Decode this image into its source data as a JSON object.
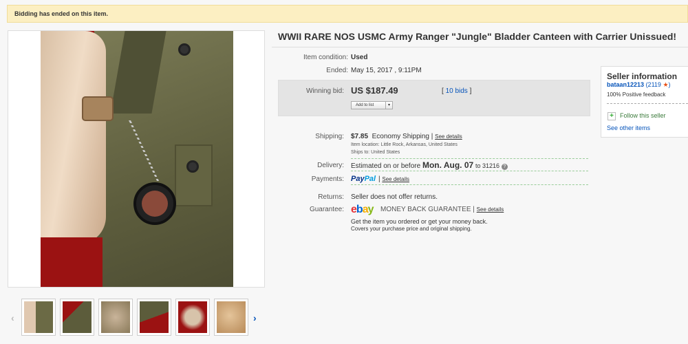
{
  "banner": {
    "text": "Bidding has ended on this item."
  },
  "title": "WWII RARE NOS USMC Army Ranger \"Jungle\" Bladder Canteen with Carrier Unissued!",
  "details": {
    "condition_label": "Item condition:",
    "condition_value": "Used",
    "ended_label": "Ended:",
    "ended_value": "May 15, 2017 , 9:11PM",
    "winning_label": "Winning bid:",
    "winning_value": "US $187.49",
    "bids_open": "[",
    "bids_link": "10 bids",
    "bids_close": "]",
    "add_to_list": "Add to list",
    "shipping_label": "Shipping:",
    "shipping_price": "$7.85",
    "shipping_method": "Economy Shipping",
    "see_details": "See details",
    "item_location": "Item location:  Little Rock, Arkansas, United States",
    "ships_to": "Ships to:  United States",
    "delivery_label": "Delivery:",
    "delivery_prefix": "Estimated on or before",
    "delivery_date": "Mon. Aug. 07",
    "delivery_suffix": "to 31216",
    "payments_label": "Payments:",
    "paypal_pay": "Pay",
    "paypal_pal": "Pal",
    "returns_label": "Returns:",
    "returns_value": "Seller does not offer returns.",
    "guarantee_label": "Guarantee:",
    "guarantee_brand": [
      "e",
      "b",
      "a",
      "y"
    ],
    "guarantee_text": "MONEY BACK GUARANTEE",
    "guarantee_line1": "Get the item you ordered or get your money back.",
    "guarantee_line2": "Covers your purchase price and original shipping."
  },
  "seller": {
    "heading": "Seller information",
    "username": "bataan12213",
    "feedback_score": "(2119",
    "star": "★",
    "close_paren": ")",
    "positive": "100% Positive feedback",
    "follow_plus": "+",
    "follow": "Follow this seller",
    "other_items": "See other items"
  },
  "gallery": {
    "prev_arrow": "‹",
    "next_arrow": "›",
    "thumb_count": 6
  },
  "colors": {
    "accent_link": "#0654ba",
    "ebay_e": "#e53238",
    "ebay_b": "#0064d2",
    "ebay_a": "#f5af02",
    "ebay_y": "#86b817",
    "paypal_dark": "#003087",
    "paypal_light": "#009cde",
    "star": "#e94f16"
  }
}
